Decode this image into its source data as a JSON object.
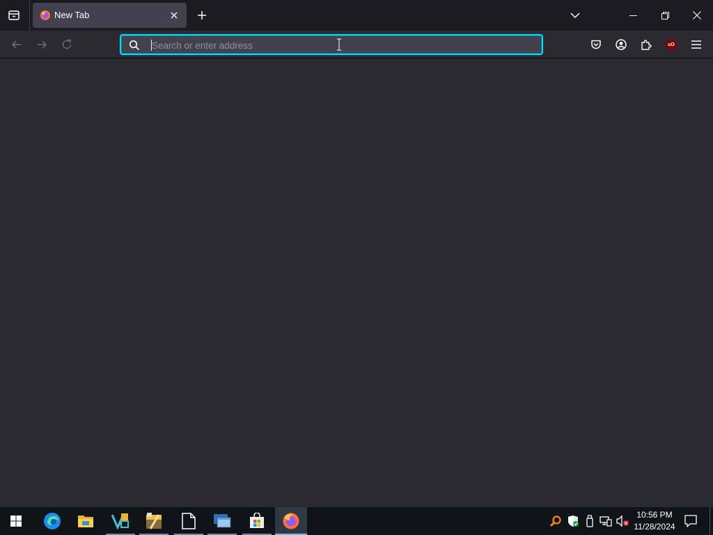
{
  "browser": {
    "tab": {
      "title": "New Tab"
    },
    "urlbar": {
      "placeholder": "Search or enter address",
      "value": ""
    }
  },
  "taskbar": {
    "apps": [
      "edge",
      "file-explorer",
      "vscode",
      "winrar",
      "document",
      "remote-desktop",
      "microsoft-store",
      "firefox"
    ],
    "active_app": "firefox",
    "clock": {
      "time": "10:56 PM",
      "date": "11/28/2024"
    }
  },
  "colors": {
    "focus_ring": "#00ddff",
    "toolbar": "#2b2a33",
    "tabstrip": "#1c1b22",
    "taskbar": "#101418"
  }
}
